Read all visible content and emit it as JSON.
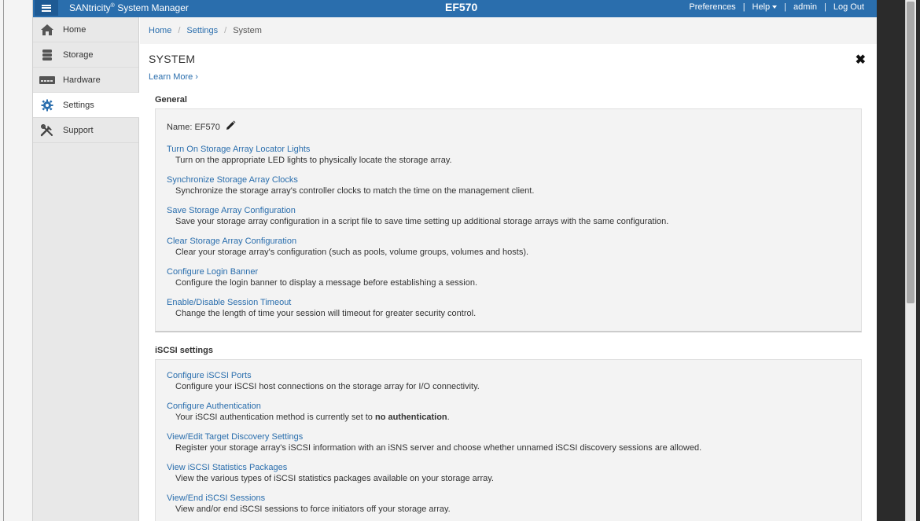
{
  "header": {
    "app_name": "SANtricity",
    "app_name_suffix": "System Manager",
    "registered_mark": "®",
    "array_name": "EF570",
    "links": {
      "preferences": "Preferences",
      "help": "Help",
      "user": "admin",
      "logout": "Log Out"
    },
    "separator": "|"
  },
  "sidebar": {
    "items": [
      {
        "label": "Home",
        "icon": "home-icon",
        "active": false
      },
      {
        "label": "Storage",
        "icon": "database-icon",
        "active": false
      },
      {
        "label": "Hardware",
        "icon": "hardware-icon",
        "active": false
      },
      {
        "label": "Settings",
        "icon": "gear-icon",
        "active": true
      },
      {
        "label": "Support",
        "icon": "tools-icon",
        "active": false
      }
    ]
  },
  "breadcrumb": {
    "items": [
      "Home",
      "Settings",
      "System"
    ],
    "separator": "/"
  },
  "page": {
    "title": "SYSTEM",
    "learn_more": "Learn More ›",
    "close_glyph": "✖"
  },
  "general": {
    "heading": "General",
    "name_label": "Name: EF570",
    "actions": [
      {
        "title": "Turn On Storage Array Locator Lights",
        "desc": "Turn on the appropriate LED lights to physically locate the storage array."
      },
      {
        "title": "Synchronize Storage Array Clocks",
        "desc": "Synchronize the storage array's controller clocks to match the time on the management client."
      },
      {
        "title": "Save Storage Array Configuration",
        "desc": "Save your storage array configuration in a script file to save time setting up additional storage arrays with the same configuration."
      },
      {
        "title": "Clear Storage Array Configuration",
        "desc": "Clear your storage array's configuration (such as pools, volume groups, volumes and hosts)."
      },
      {
        "title": "Configure Login Banner",
        "desc": "Configure the login banner to display a message before establishing a session."
      },
      {
        "title": "Enable/Disable Session Timeout",
        "desc": "Change the length of time your session will timeout for greater security control."
      }
    ]
  },
  "iscsi": {
    "heading": "iSCSI settings",
    "actions": [
      {
        "title": "Configure iSCSI Ports",
        "desc": "Configure your iSCSI host connections on the storage array for I/O connectivity."
      },
      {
        "title": "Configure Authentication",
        "desc_prefix": "Your iSCSI authentication method is currently set to",
        "desc_bold": "no authentication",
        "desc_suffix": "."
      },
      {
        "title": "View/Edit Target Discovery Settings",
        "desc": "Register your storage array's iSCSI information with an iSNS server and choose whether unnamed iSCSI discovery sessions are allowed."
      },
      {
        "title": "View iSCSI Statistics Packages",
        "desc": "View the various types of iSCSI statistics packages available on your storage array."
      },
      {
        "title": "View/End iSCSI Sessions",
        "desc": "View and/or end iSCSI sessions to force initiators off your storage array."
      }
    ]
  },
  "colors": {
    "header": "#2a6ead",
    "link": "#2a6ead",
    "sidebar": "#e8e8e8",
    "panel": "#f3f3f3"
  }
}
